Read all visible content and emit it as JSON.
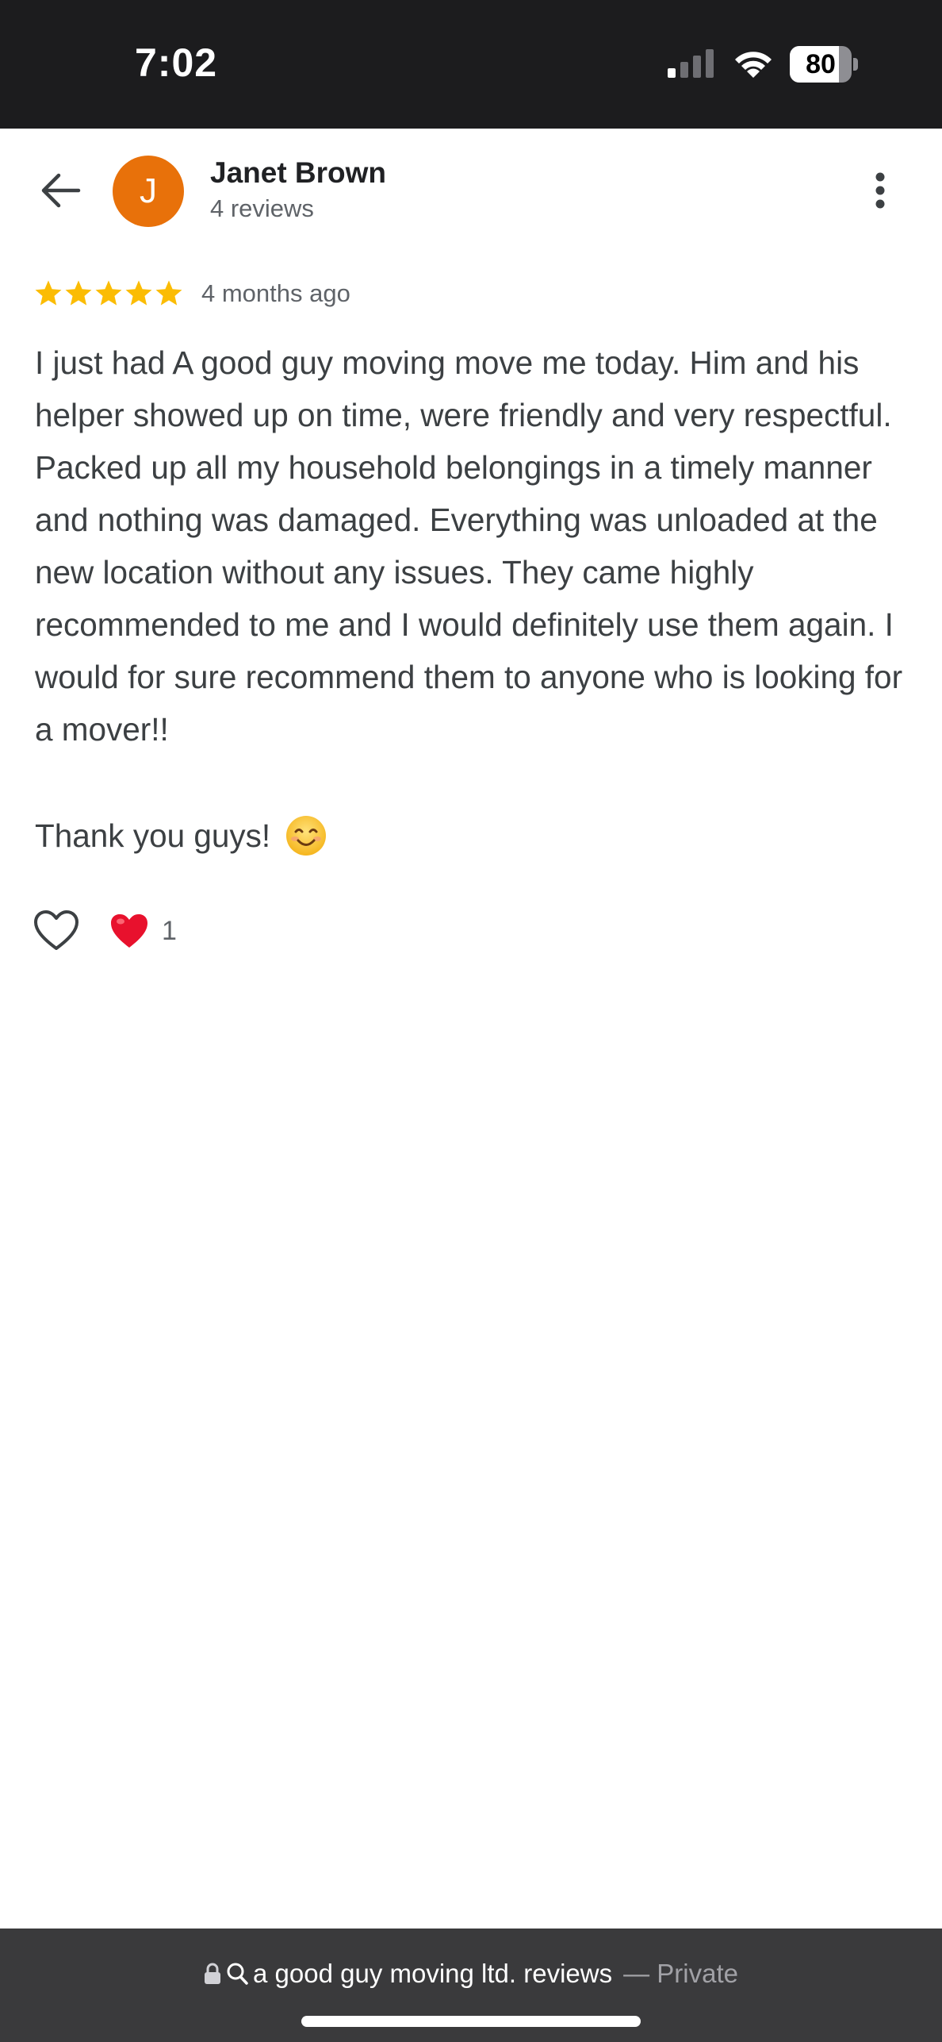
{
  "status_bar": {
    "time": "7:02",
    "battery_level": 80,
    "battery_label": "80"
  },
  "header": {
    "avatar_initial": "J",
    "avatar_color": "#e8710a",
    "reviewer_name": "Janet Brown",
    "review_count": "4 reviews",
    "back_icon": "arrow-left-icon",
    "menu_icon": "more-vertical-icon"
  },
  "review": {
    "rating": 5,
    "max_rating": 5,
    "star_color": "#fbbc04",
    "date": "4 months ago",
    "body": "I just had A good guy moving move me today. Him and his helper showed up on time, were friendly and very respectful. Packed up all my household belongings in a timely manner and nothing was damaged. Everything was unloaded at the new location without any issues. They came highly recommended to me and I would definitely use them again. I would for sure recommend them to anyone who is looking for a mover!!",
    "closing": "Thank you guys!",
    "closing_emoji": "smiling-face-icon"
  },
  "reactions": {
    "like_icon": "heart-outline-icon",
    "reaction_icon": "red-heart-icon",
    "count": "1"
  },
  "url_bar": {
    "url_text": "a good guy moving ltd. reviews",
    "suffix": "— Private",
    "lock_icon": "lock-icon",
    "search_icon": "search-icon"
  }
}
